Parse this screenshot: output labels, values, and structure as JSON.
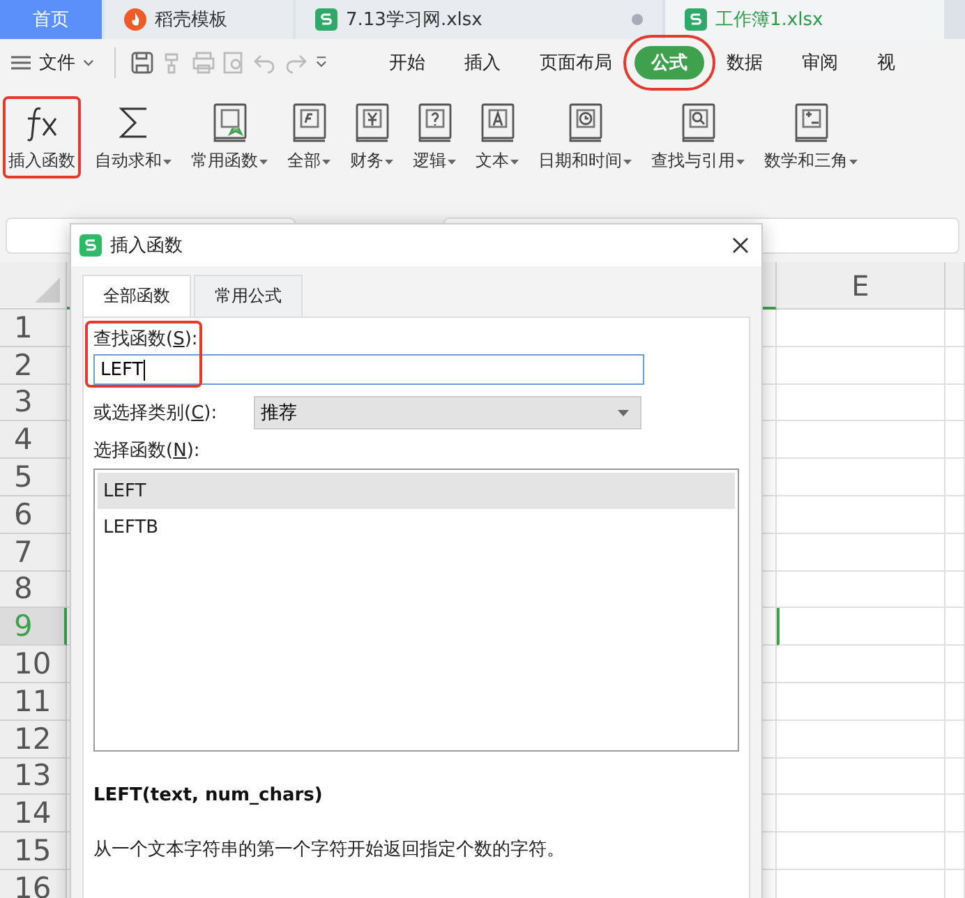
{
  "doc_tabs": [
    {
      "label": "首页",
      "kind": "home",
      "selected": false,
      "unsaved": false
    },
    {
      "label": "稻壳模板",
      "kind": "template",
      "selected": false,
      "unsaved": false
    },
    {
      "label": "7.13学习网.xlsx",
      "kind": "sheet",
      "selected": false,
      "unsaved": true
    },
    {
      "label": "工作簿1.xlsx",
      "kind": "sheet",
      "selected": true,
      "unsaved": false
    }
  ],
  "menu": {
    "file": "文件",
    "tabs": [
      {
        "label": "开始",
        "selected": false,
        "highlighted": false
      },
      {
        "label": "插入",
        "selected": false,
        "highlighted": false
      },
      {
        "label": "页面布局",
        "selected": false,
        "highlighted": false
      },
      {
        "label": "公式",
        "selected": true,
        "highlighted": true
      },
      {
        "label": "数据",
        "selected": false,
        "highlighted": false
      },
      {
        "label": "审阅",
        "selected": false,
        "highlighted": false
      },
      {
        "label": "视",
        "selected": false,
        "highlighted": false
      }
    ]
  },
  "ribbon": [
    {
      "label": "插入函数",
      "dropdown": false,
      "highlighted": true
    },
    {
      "label": "自动求和",
      "dropdown": true,
      "highlighted": false
    },
    {
      "label": "常用函数",
      "dropdown": true,
      "highlighted": false
    },
    {
      "label": "全部",
      "dropdown": true,
      "highlighted": false
    },
    {
      "label": "财务",
      "dropdown": true,
      "highlighted": false
    },
    {
      "label": "逻辑",
      "dropdown": true,
      "highlighted": false
    },
    {
      "label": "文本",
      "dropdown": true,
      "highlighted": false
    },
    {
      "label": "日期和时间",
      "dropdown": true,
      "highlighted": false
    },
    {
      "label": "查找与引用",
      "dropdown": true,
      "highlighted": false
    },
    {
      "label": "数学和三角",
      "dropdown": true,
      "highlighted": false
    }
  ],
  "sheet": {
    "columns": [
      {
        "label": "E"
      }
    ],
    "rows": [
      {
        "label": "1",
        "selected": false
      },
      {
        "label": "2",
        "selected": false
      },
      {
        "label": "3",
        "selected": false
      },
      {
        "label": "4",
        "selected": false
      },
      {
        "label": "5",
        "selected": false
      },
      {
        "label": "6",
        "selected": false
      },
      {
        "label": "7",
        "selected": false
      },
      {
        "label": "8",
        "selected": false
      },
      {
        "label": "9",
        "selected": true
      },
      {
        "label": "10",
        "selected": false
      },
      {
        "label": "11",
        "selected": false
      },
      {
        "label": "12",
        "selected": false
      },
      {
        "label": "13",
        "selected": false
      },
      {
        "label": "14",
        "selected": false
      },
      {
        "label": "15",
        "selected": false
      },
      {
        "label": "16",
        "selected": false
      }
    ]
  },
  "dialog": {
    "title": "插入函数",
    "tabs": [
      {
        "label": "全部函数",
        "selected": true
      },
      {
        "label": "常用公式",
        "selected": false
      }
    ],
    "search": {
      "label_before": "查找函数(",
      "accesskey": "S",
      "label_after": "):",
      "value": "LEFT",
      "highlighted": true
    },
    "category": {
      "label_before": "或选择类别(",
      "accesskey": "C",
      "label_after": "):",
      "value": "推荐"
    },
    "functions": {
      "label_before": "选择函数(",
      "accesskey": "N",
      "label_after": "):",
      "items": [
        {
          "label": "LEFT",
          "selected": true
        },
        {
          "label": "LEFTB",
          "selected": false
        }
      ]
    },
    "signature": "LEFT(text, num_chars)",
    "description": "从一个文本字符串的第一个字符开始返回指定个数的字符。"
  }
}
